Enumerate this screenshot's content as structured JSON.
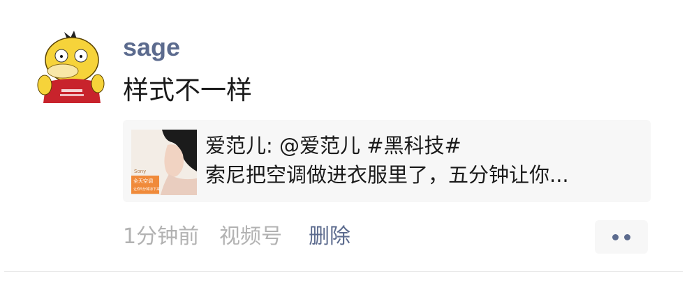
{
  "post": {
    "username": "sage",
    "text": "样式不一样",
    "avatar_icon": "psyduck-avatar-icon"
  },
  "shared_link": {
    "title": "爱范儿: @爱范儿 #黑科技#",
    "description": "索尼把空调做进衣服里了，五分钟让你...",
    "thumbnail_text": {
      "line1": "Sony",
      "line2": "全天空调",
      "line3": "让你5分钟凉下来"
    }
  },
  "meta": {
    "time": "1分钟前",
    "source": "视频号",
    "delete_label": "删除"
  },
  "actions": {
    "more_icon": "more-dots-icon"
  },
  "colors": {
    "link_blue": "#5c6b8e",
    "meta_gray": "#b2b2b2",
    "card_bg": "#f7f7f7",
    "divider": "#e8e8e8"
  }
}
